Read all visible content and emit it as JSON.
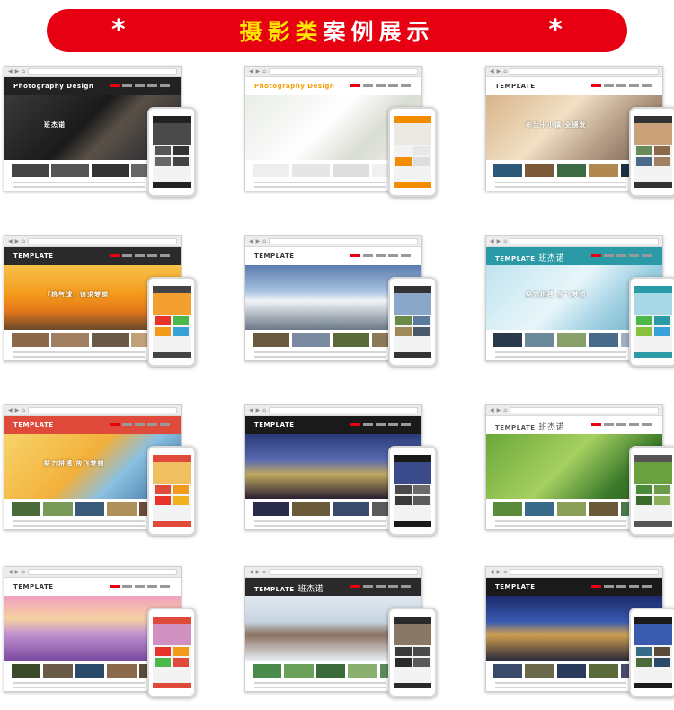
{
  "banner": {
    "star": "*",
    "highlight": "摄影类",
    "rest": "案例展示",
    "bg": "#e60012",
    "highlight_color": "#ffe400"
  },
  "cards": [
    {
      "brand": "Photography Design",
      "brand_cn": "",
      "hero_text": "班杰诺",
      "head_bg": "#222222",
      "brand_color": "#ffffff",
      "hero": "linear-gradient(135deg,#3a3a3a,#1a1a1a 45%,#5a5048 60%,#20242c)",
      "thumbs": [
        "#444444",
        "#555555",
        "#333333",
        "#666666"
      ],
      "phone_top": "#222222",
      "phone_img": "#4a4a4a",
      "phone_grid": [
        "#555555",
        "#333333",
        "#666666",
        "#444444"
      ],
      "phone_bar": "#222222"
    },
    {
      "brand": "Photography Design",
      "brand_cn": "",
      "hero_text": "",
      "head_bg": "#ffffff",
      "brand_color": "#f4a000",
      "hero": "linear-gradient(135deg,#e8ece6,#ffffff 45%,#d9ddd3 70%,#f1f1ed)",
      "thumbs": [
        "#eeeeee",
        "#e6e6e6",
        "#dddddd",
        "#f0f0f0"
      ],
      "phone_top": "#f28c00",
      "phone_img": "#ece8e2",
      "phone_grid": [
        "#f2f2f2",
        "#e8e8e8",
        "#f28c00",
        "#dddddd"
      ],
      "phone_bar": "#f28c00"
    },
    {
      "brand": "TEMPLATE",
      "brand_cn": "",
      "hero_text": "布兰卡小镇 全镜发",
      "head_bg": "#ffffff",
      "brand_color": "#333333",
      "hero": "linear-gradient(135deg,#d8b48a,#f1e0c4 40%,#b9a08a 65%,#6f5a48)",
      "thumbs": [
        "#2c5a78",
        "#7a5a38",
        "#3c6a44",
        "#b08850",
        "#1c3040"
      ],
      "phone_top": "#333333",
      "phone_img": "#c9a27a",
      "phone_grid": [
        "#6a8a5a",
        "#8a6a4a",
        "#4a6a8a",
        "#a08060"
      ],
      "phone_bar": "#333333"
    },
    {
      "brand": "TEMPLATE",
      "brand_cn": "",
      "hero_text": "「热气球」追求梦想",
      "head_bg": "#2a2a2a",
      "brand_color": "#ffffff",
      "hero": "linear-gradient(180deg,#f7c24a,#f39a1c 45%,#e6781a 70%,#6a4a2a)",
      "thumbs": [
        "#8a6a48",
        "#a08060",
        "#6a5a48",
        "#c0a078"
      ],
      "phone_top": "#444444",
      "phone_img": "#f3a030",
      "phone_grid": [
        "#e8332a",
        "#4cb84a",
        "#f29a1a",
        "#3aa0d8"
      ],
      "phone_bar": "#444444"
    },
    {
      "brand": "TEMPLATE",
      "brand_cn": "",
      "hero_text": "",
      "head_bg": "#ffffff",
      "brand_color": "#333333",
      "hero": "linear-gradient(180deg,#5a7cb0,#a6c0de 40%,#f2f4f8 55%,#6a7888)",
      "thumbs": [
        "#6a5a40",
        "#7a8aa0",
        "#5a6a3a",
        "#8a7a5a"
      ],
      "phone_top": "#333333",
      "phone_img": "#8aa6c8",
      "phone_grid": [
        "#6a8a4a",
        "#5a7aa0",
        "#a08a5a",
        "#4a5a6a"
      ],
      "phone_bar": "#333333"
    },
    {
      "brand": "TEMPLATE",
      "brand_cn": "班杰诺",
      "hero_text": "努力拼搏 放飞梦想",
      "head_bg": "#2a9aa6",
      "brand_color": "#ffffff",
      "hero": "linear-gradient(135deg,#bfe3ee,#e8f6fa 45%,#9ed0e2 70%,#6aa8c0)",
      "thumbs": [
        "#2a3a4a",
        "#6a8a9a",
        "#8aa06a",
        "#4a6a8a",
        "#a0b0c0"
      ],
      "phone_top": "#2a9aa6",
      "phone_img": "#a8d8e6",
      "phone_grid": [
        "#4cb84a",
        "#2a9aa6",
        "#8ac040",
        "#3aa0d8"
      ],
      "phone_bar": "#2a9aa6"
    },
    {
      "brand": "TEMPLATE",
      "brand_cn": "",
      "hero_text": "努力拼搏 放飞梦想",
      "head_bg": "#e04a3a",
      "brand_color": "#ffffff",
      "hero": "linear-gradient(135deg,#f6d46a,#f3b03a 45%,#8ac0e0 65%,#3a6aa0)",
      "thumbs": [
        "#4a6a3a",
        "#7a9a5a",
        "#3a5a7a",
        "#b0905a",
        "#6a4a3a"
      ],
      "phone_top": "#e04a3a",
      "phone_img": "#f0c060",
      "phone_grid": [
        "#e04a3a",
        "#f29a1a",
        "#e8332a",
        "#f0b020"
      ],
      "phone_bar": "#e04a3a"
    },
    {
      "brand": "TEMPLATE",
      "brand_cn": "",
      "hero_text": "",
      "head_bg": "#1a1a1a",
      "brand_color": "#ffffff",
      "hero": "linear-gradient(180deg,#2a3a78,#5a6ab0 40%,#c0a860 62%,#2a2030)",
      "thumbs": [
        "#2a2a4a",
        "#6a5a3a",
        "#3a4a6a",
        "#5a5a5a"
      ],
      "phone_top": "#1a1a1a",
      "phone_img": "#3a4a8a",
      "phone_grid": [
        "#4a4a4a",
        "#6a6a6a",
        "#3a3a3a",
        "#5a5a5a"
      ],
      "phone_bar": "#1a1a1a"
    },
    {
      "brand": "TEMPLATE",
      "brand_cn": "班杰诺",
      "hero_text": "",
      "head_bg": "#ffffff",
      "brand_color": "#555555",
      "hero": "linear-gradient(135deg,#6aa83a,#a6d060 45%,#3a7a2a 75%,#2a5a1a)",
      "thumbs": [
        "#5a8a3a",
        "#3a6a8a",
        "#8aa05a",
        "#6a5a3a",
        "#4a7a4a"
      ],
      "phone_top": "#555555",
      "phone_img": "#6aa040",
      "phone_grid": [
        "#4a8a3a",
        "#6a9a4a",
        "#3a6a2a",
        "#8ab05a"
      ],
      "phone_bar": "#555555"
    },
    {
      "brand": "TEMPLATE",
      "brand_cn": "",
      "hero_text": "",
      "head_bg": "#ffffff",
      "brand_color": "#333333",
      "hero": "linear-gradient(180deg,#f0a0c0,#f6d0a0 35%,#c090d0 60%,#7a4aa0)",
      "thumbs": [
        "#3a4a2a",
        "#6a5a48",
        "#2a4a6a",
        "#8a6a4a",
        "#5a4a3a"
      ],
      "phone_top": "#e04a3a",
      "phone_img": "#d090c0",
      "phone_grid": [
        "#e8332a",
        "#f29a1a",
        "#4cb84a",
        "#e04a3a"
      ],
      "phone_bar": "#e04a3a"
    },
    {
      "brand": "TEMPLATE",
      "brand_cn": "班杰诺",
      "hero_text": "",
      "head_bg": "#2a2a2a",
      "brand_color": "#ffffff",
      "hero": "linear-gradient(180deg,#dfe8f0,#c6d4e0 40%,#8a7060 60%,#e8eef4)",
      "thumbs": [
        "#4a8a4a",
        "#6aa05a",
        "#3a6a3a",
        "#8ab070",
        "#5a8a5a"
      ],
      "phone_top": "#2a2a2a",
      "phone_img": "#8a7866",
      "phone_grid": [
        "#3a3a3a",
        "#4a4a4a",
        "#2a2a2a",
        "#5a5a5a"
      ],
      "phone_bar": "#2a2a2a"
    },
    {
      "brand": "TEMPLATE",
      "brand_cn": "",
      "hero_text": "",
      "head_bg": "#1a1a1a",
      "brand_color": "#ffffff",
      "hero": "linear-gradient(180deg,#1a2a6a,#3a5ab0 40%,#d0a050 60%,#2a2a3a)",
      "thumbs": [
        "#3a4a6a",
        "#6a6a4a",
        "#2a3a5a",
        "#5a6a3a",
        "#4a4a6a"
      ],
      "phone_top": "#1a1a1a",
      "phone_img": "#3a5ab0",
      "phone_grid": [
        "#3a6a8a",
        "#5a4a3a",
        "#4a6a3a",
        "#2a4a6a"
      ],
      "phone_bar": "#1a1a1a"
    }
  ]
}
